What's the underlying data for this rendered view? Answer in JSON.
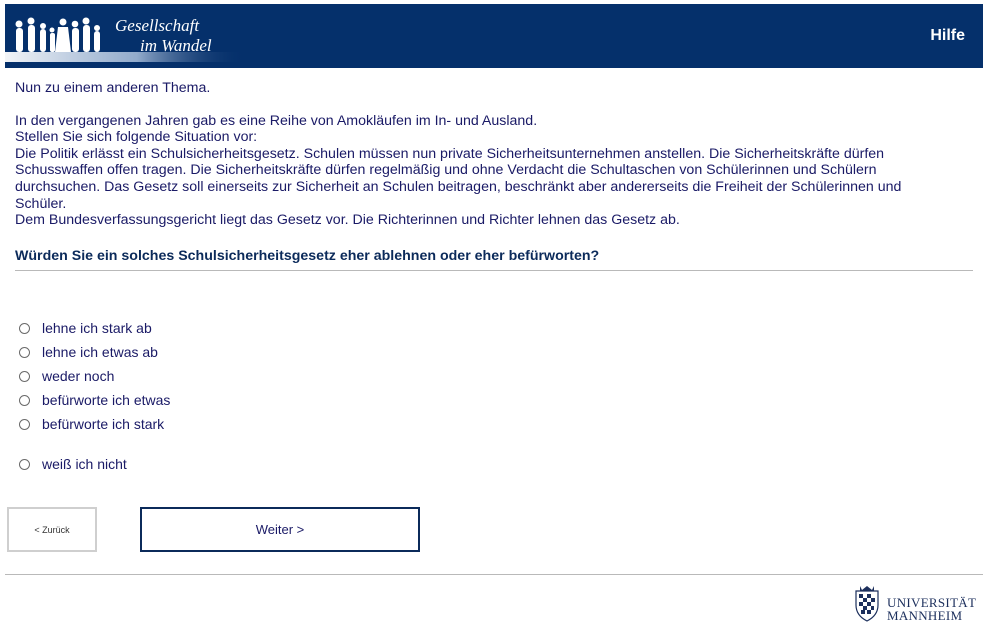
{
  "header": {
    "logo_line1": "Gesellschaft",
    "logo_line2": "im Wandel",
    "help_label": "Hilfe"
  },
  "intro": {
    "p1": "Nun zu einem anderen Thema.",
    "p2": "In den vergangenen Jahren gab es eine Reihe von Amokläufen im In- und Ausland.",
    "p3": "Stellen Sie sich folgende Situation vor:",
    "p4": "Die Politik erlässt ein Schulsicherheitsgesetz. Schulen müssen nun private Sicherheitsunternehmen anstellen. Die Sicherheitskräfte dürfen Schusswaffen offen tragen. Die Sicherheitskräfte dürfen regelmäßig und ohne Verdacht die Schultaschen von Schülerinnen und Schülern durchsuchen. Das Gesetz soll einerseits zur Sicherheit an Schulen beitragen, beschränkt aber andererseits die Freiheit der Schülerinnen und Schüler.",
    "p5": "Dem Bundesverfassungsgericht liegt das Gesetz vor. Die Richterinnen und Richter lehnen das Gesetz ab."
  },
  "question": "Würden Sie ein solches Schulsicherheitsgesetz eher ablehnen oder eher befürworten?",
  "options": [
    "lehne ich stark ab",
    "lehne ich etwas ab",
    "weder noch",
    "befürworte ich etwas",
    "befürworte ich stark",
    "weiß ich nicht"
  ],
  "nav": {
    "back_label": "< Zurück",
    "next_label": "Weiter >"
  },
  "footer": {
    "uni_line1": "UNIVERSITÄT",
    "uni_line2": "MANNHEIM"
  }
}
